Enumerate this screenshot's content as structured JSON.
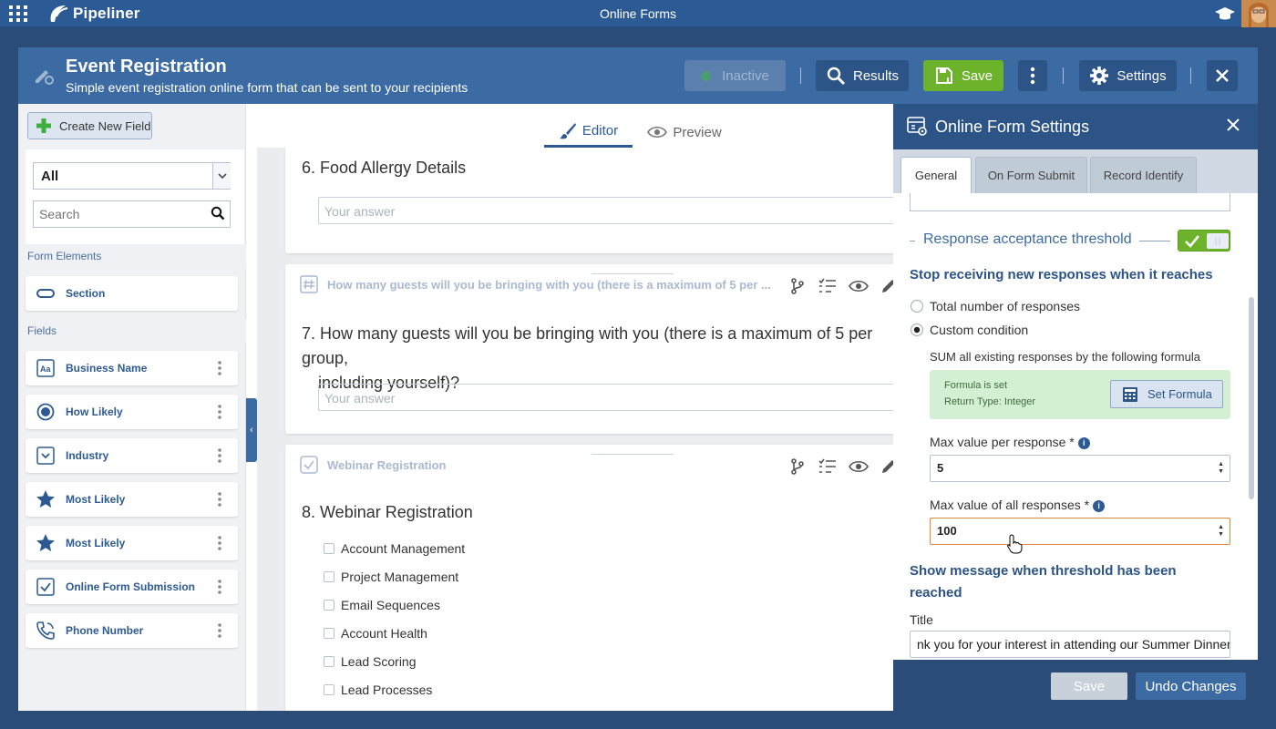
{
  "topbar": {
    "logo": "Pipeliner",
    "title": "Online Forms"
  },
  "header": {
    "title": "Event Registration",
    "subtitle": "Simple event registration online form that can be sent to your recipients",
    "inactive_label": "Inactive",
    "results_label": "Results",
    "save_label": "Save",
    "settings_label": "Settings"
  },
  "left": {
    "create_label": "Create New Field",
    "filter_value": "All",
    "search_placeholder": "Search",
    "form_elements_label": "Form Elements",
    "section_label": "Section",
    "fields_label": "Fields",
    "fields": [
      {
        "label": "Business Name",
        "icon": "text-field-icon"
      },
      {
        "label": "How Likely",
        "icon": "radio-icon"
      },
      {
        "label": "Industry",
        "icon": "dropdown-icon"
      },
      {
        "label": "Most Likely",
        "icon": "star-icon"
      },
      {
        "label": "Most Likely",
        "icon": "star-icon"
      },
      {
        "label": "Online Form Submission",
        "icon": "checkbox-icon"
      },
      {
        "label": "Phone Number",
        "icon": "phone-icon"
      }
    ]
  },
  "editor": {
    "tab_editor": "Editor",
    "tab_preview": "Preview",
    "q6_title": "6. Food Allergy Details",
    "answer_placeholder": "Your answer",
    "q7_head": "How many guests will you be bringing with you (there is a maximum of 5 per ...",
    "q7_title_line1": "7. How many guests will you be bringing with you (there is a maximum of 5 per group,",
    "q7_title_line2": "including yourself)?",
    "q8_head": "Webinar Registration",
    "q8_title": "8. Webinar Registration",
    "options": [
      "Account Management",
      "Project Management",
      "Email Sequences",
      "Account Health",
      "Lead Scoring",
      "Lead Processes"
    ]
  },
  "settings": {
    "title": "Online Form Settings",
    "tabs": [
      "General",
      "On Form Submit",
      "Record Identify"
    ],
    "threshold_label": "Response acceptance threshold",
    "stop_heading": "Stop receiving new responses when it reaches",
    "radio_total": "Total number of responses",
    "radio_custom": "Custom condition",
    "sum_text": "SUM all existing responses by the following formula",
    "formula_set": "Formula is set",
    "return_type": "Return Type: Integer",
    "set_formula_label": "Set Formula",
    "max_per_label": "Max value per response *",
    "max_per_value": "5",
    "max_all_label": "Max value of all responses *",
    "max_all_value": "100",
    "show_msg_heading": "Show message when threshold has been reached",
    "title_label": "Title",
    "title_value": "nk you for your interest in attending our Summer Dinner",
    "save_label": "Save",
    "undo_label": "Undo Changes"
  },
  "colors": {
    "accent": "#2d5487",
    "save_green": "#6cb22b",
    "formula_bg": "#d4f0d4"
  }
}
